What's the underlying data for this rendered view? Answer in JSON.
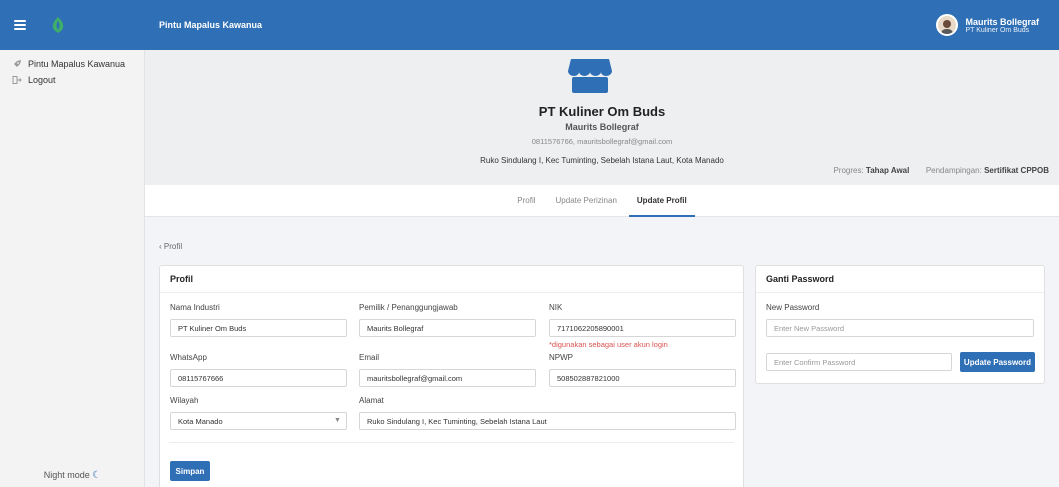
{
  "topbar": {
    "app_title": "Pintu Mapalus Kawanua",
    "user_name": "Maurits Bollegraf",
    "user_company": "PT Kuliner Om Buds"
  },
  "sidebar": {
    "items": [
      {
        "label": "Pintu Mapalus Kawanua",
        "icon": "rocket-icon"
      },
      {
        "label": "Logout",
        "icon": "logout-icon"
      }
    ],
    "night_mode": "Night mode"
  },
  "hero": {
    "company": "PT Kuliner Om Buds",
    "owner": "Maurits Bollegraf",
    "contact": "0811576766, mauritsbollegraf@gmail.com",
    "address": "Ruko Sindulang I, Kec Tuminting, Sebelah Istana Laut, Kota Manado",
    "progress_label": "Progres:",
    "progress_value": "Tahap Awal",
    "pendampingan_label": "Pendampingan:",
    "pendampingan_value": "Sertifikat CPPOB"
  },
  "tabs": [
    {
      "label": "Profil",
      "active": false
    },
    {
      "label": "Update Perizinan",
      "active": false
    },
    {
      "label": "Update Profil",
      "active": true
    }
  ],
  "breadcrumb": "‹ Profil",
  "profil_card": {
    "title": "Profil",
    "fields": {
      "nama_industri": {
        "label": "Nama Industri",
        "value": "PT Kuliner Om Buds"
      },
      "pemilik": {
        "label": "Pemilik / Penanggungjawab",
        "value": "Maurits Bollegraf"
      },
      "nik": {
        "label": "NIK",
        "value": "7171062205890001",
        "hint": "*digunakan sebagai user akun login"
      },
      "whatsapp": {
        "label": "WhatsApp",
        "value": "08115767666"
      },
      "email": {
        "label": "Email",
        "value": "mauritsbollegraf@gmail.com"
      },
      "npwp": {
        "label": "NPWP",
        "value": "508502887821000"
      },
      "wilayah": {
        "label": "Wilayah",
        "value": "Kota Manado"
      },
      "alamat": {
        "label": "Alamat",
        "value": "Ruko Sindulang I, Kec Tuminting, Sebelah Istana Laut"
      }
    },
    "save_label": "Simpan"
  },
  "password_card": {
    "title": "Ganti Password",
    "new_label": "New Password",
    "new_placeholder": "Enter New Password",
    "confirm_placeholder": "Enter Confirm Password",
    "update_label": "Update Password"
  },
  "colors": {
    "primary": "#2f6fb5",
    "danger": "#d9534f"
  }
}
